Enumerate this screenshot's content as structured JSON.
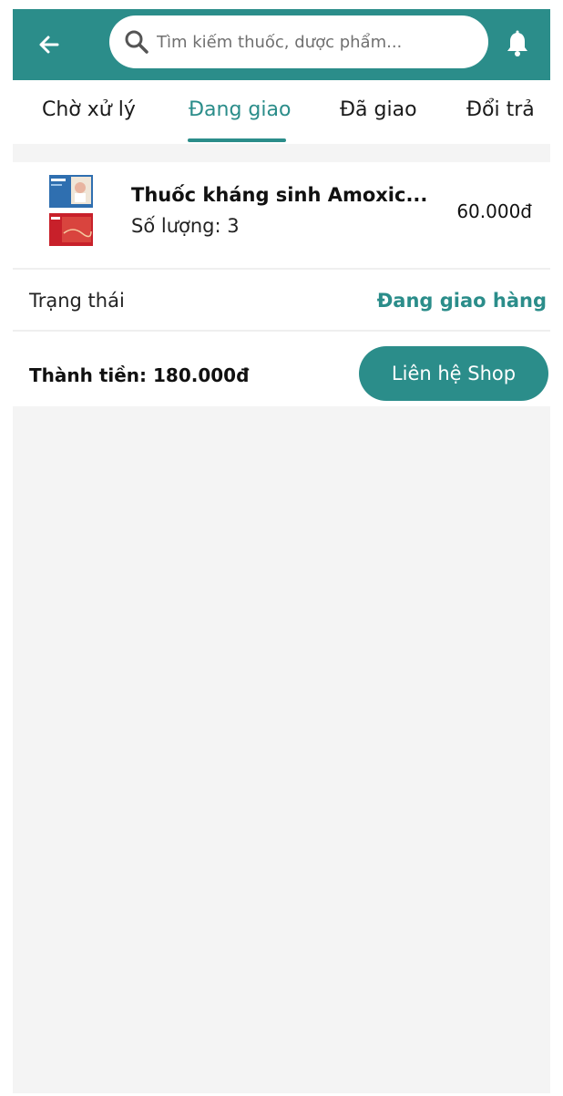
{
  "header": {
    "back_icon": "arrow-left-icon",
    "search_placeholder": "Tìm kiếm thuốc, dược phẩm...",
    "search_icon": "search-icon",
    "bell_icon": "bell-icon",
    "brand_color": "#2b8d8a"
  },
  "tabs": [
    {
      "label": "Chờ xử lý",
      "active": false
    },
    {
      "label": "Đang giao",
      "active": true
    },
    {
      "label": "Đã giao",
      "active": false
    },
    {
      "label": "Đổi trả",
      "active": false
    }
  ],
  "order": {
    "product_name": "Thuốc kháng sinh Amoxic...",
    "quantity_text": "Số lượng: 3",
    "price": "60.000đ",
    "status_label": "Trạng thái",
    "status_value": "Đang giao hàng",
    "total_text": "Thành tiền: 180.000đ",
    "contact_label": "Liên hệ Shop"
  }
}
